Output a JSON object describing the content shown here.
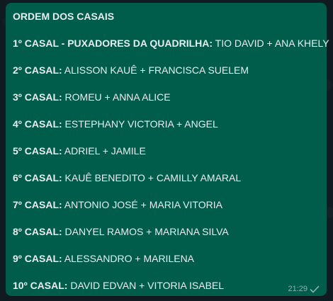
{
  "message": {
    "heading": "ORDEM DOS CASAIS",
    "rows": [
      {
        "label": "1º CASAL - PUXADORES DA QUADRILHA:",
        "names": " TIO DAVID + ANA KHELY"
      },
      {
        "label": "2º CASAL:",
        "names": " ALISSON KAUÊ  + FRANCISCA SUELEM"
      },
      {
        "label": "3º CASAL:",
        "names": " ROMEU + ANNA ALICE"
      },
      {
        "label": "4º CASAL:",
        "names": " ESTEPHANY VICTORIA  + ANGEL"
      },
      {
        "label": "5º CASAL:",
        "names": " ADRIEL + JAMILE"
      },
      {
        "label": "6º CASAL:",
        "names": " KAUÊ BENEDITO  + CAMILLY AMARAL"
      },
      {
        "label": "7º CASAL:",
        "names": " ANTONIO JOSÉ  + MARIA VITORIA"
      },
      {
        "label": "8º CASAL:",
        "names": " DANYEL RAMOS  + MARIANA SILVA"
      },
      {
        "label": "9º CASAL:",
        "names": " ALESSANDRO  + MARILENA"
      },
      {
        "label": "10º CASAL:",
        "names": "  DAVID EDVAN  + VITORIA ISABEL"
      }
    ],
    "time": "21:29",
    "status_icon": "single-check-icon"
  },
  "colors": {
    "bubble": "#005c4b",
    "text": "#e9edef",
    "background": "#0f1b20"
  }
}
